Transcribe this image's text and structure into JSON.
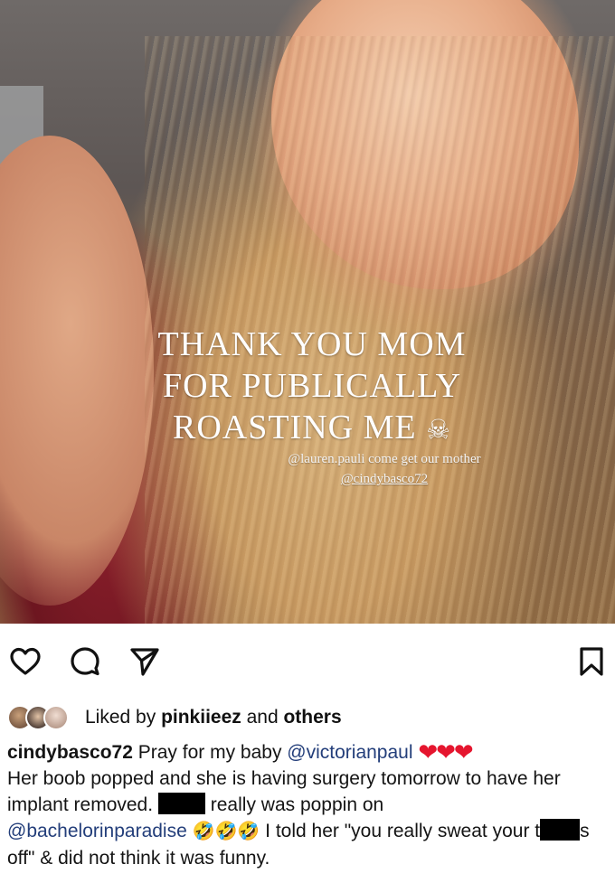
{
  "photo": {
    "story_text_lines": [
      "THANK YOU MOM",
      "FOR PUBLICALLY",
      "ROASTING ME"
    ],
    "story_emoji": "☠",
    "mention_lines": [
      "@lauren.pauli come get our mother",
      "@cindybasco72"
    ]
  },
  "actions": {
    "icons": [
      "heart-icon",
      "comment-icon",
      "share-icon",
      "bookmark-icon"
    ]
  },
  "likes": {
    "prefix": "Liked by ",
    "user": "pinkiieez",
    "middle": " and ",
    "others": "others"
  },
  "caption": {
    "username": "cindybasco72",
    "text1": " Pray for my baby ",
    "mention1": "@victorianpaul",
    "hearts": "❤❤❤",
    "text2": "Her boob popped and she is having surgery tomorrow to have her implant removed.",
    "text3": " really was poppin on",
    "mention2": "@bachelorinparadise",
    "emojis": "🤣🤣🤣",
    "text4": " I told her \"you really sweat your t",
    "text5": "s off\" & did not think it was funny."
  },
  "colors": {
    "mention": "#233e7a",
    "heart": "#e5152e"
  }
}
